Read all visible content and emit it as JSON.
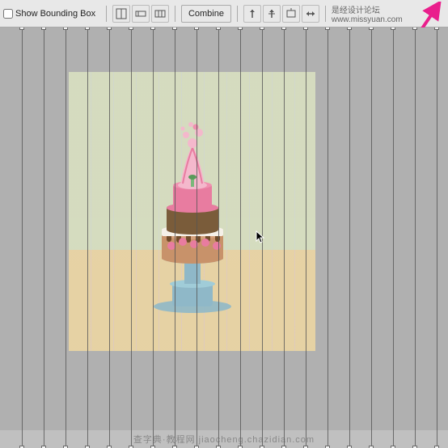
{
  "toolbar": {
    "show_bounding_box_label": "Show Bounding Box",
    "combine_label": "Combine",
    "checkbox_checked": false
  },
  "canvas": {
    "background_color": "#b0b0b0"
  },
  "watermark": {
    "text": "查字典·教程网  jiaocheng.chazidian.com"
  },
  "slice_lines": {
    "positions": [
      8,
      37,
      65,
      93,
      121,
      150,
      178,
      206,
      234,
      262,
      290,
      318,
      346,
      374,
      402,
      430,
      458,
      486,
      514,
      542
    ]
  },
  "icons": {
    "checkbox": "☐",
    "cursor": "↖",
    "arrow": "➜"
  }
}
